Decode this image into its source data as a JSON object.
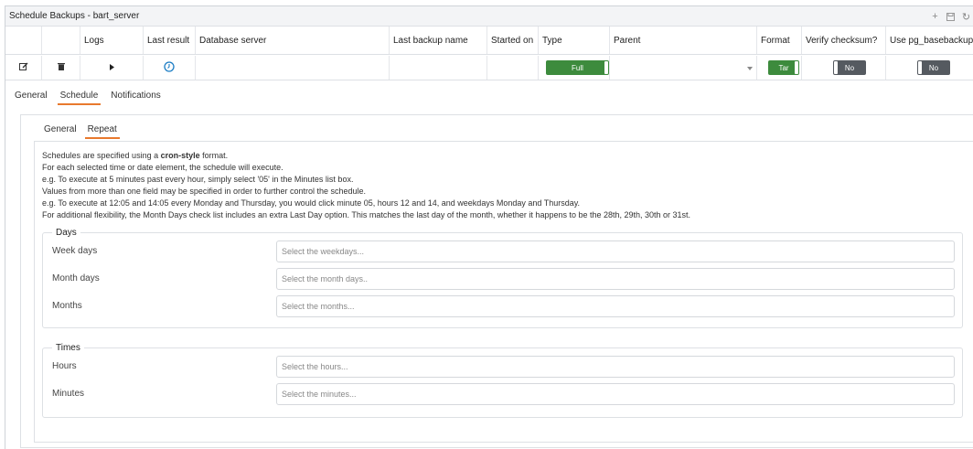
{
  "window": {
    "title": "Schedule Backups - bart_server"
  },
  "grid": {
    "columns": {
      "logs": "Logs",
      "last_result": "Last result",
      "database_server": "Database server",
      "last_backup_name": "Last backup name",
      "started_on": "Started on",
      "type": "Type",
      "parent": "Parent",
      "format": "Format",
      "verify_checksum": "Verify checksum?",
      "use_pg_basebackup": "Use pg_basebackup?"
    },
    "row": {
      "type_value": "Full",
      "parent_value": "",
      "format_value": "Tar",
      "verify_checksum_value": "No",
      "use_pg_basebackup_value": "No"
    }
  },
  "tabs": [
    "General",
    "Schedule",
    "Notifications"
  ],
  "subtabs": [
    "General",
    "Repeat"
  ],
  "help": {
    "line1_prefix": "Schedules are specified using a ",
    "line1_bold": "cron-style",
    "line1_suffix": " format.",
    "line2": "For each selected time or date element, the schedule will execute.",
    "line3": "e.g. To execute at 5 minutes past every hour, simply select '05' in the Minutes list box.",
    "line4": "Values from more than one field may be specified in order to further control the schedule.",
    "line5": "e.g. To execute at 12:05 and 14:05 every Monday and Thursday, you would click minute 05, hours 12 and 14, and weekdays Monday and Thursday.",
    "line6": "For additional flexibility, the Month Days check list includes an extra Last Day option. This matches the last day of the month, whether it happens to be the 28th, 29th, 30th or 31st."
  },
  "days": {
    "legend": "Days",
    "week_days_label": "Week days",
    "week_days_placeholder": "Select the weekdays...",
    "month_days_label": "Month days",
    "month_days_placeholder": "Select the month days..",
    "months_label": "Months",
    "months_placeholder": "Select the months..."
  },
  "times": {
    "legend": "Times",
    "hours_label": "Hours",
    "hours_placeholder": "Select the hours...",
    "minutes_label": "Minutes",
    "minutes_placeholder": "Select the minutes..."
  },
  "colors": {
    "accent_orange": "#e8792d",
    "toggle_on": "#3d8b3d",
    "toggle_off": "#555a60",
    "info_blue": "#1a7cc4"
  },
  "icons": [
    "add-icon",
    "save-icon",
    "refresh-icon",
    "edit-icon",
    "delete-icon",
    "expand-caret-icon",
    "clock-icon",
    "dropdown-caret-icon"
  ]
}
